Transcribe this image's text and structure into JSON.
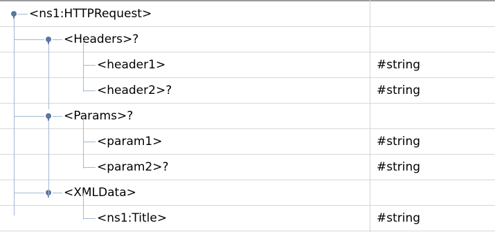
{
  "tree": {
    "rows": [
      {
        "label": "<ns1:HTTPRequest>",
        "value": "",
        "level": 0,
        "expander": "expanded"
      },
      {
        "label": "<Headers>?",
        "value": "",
        "level": 1,
        "expander": "expanded"
      },
      {
        "label": "<header1>",
        "value": "#string",
        "level": 2,
        "expander": "none"
      },
      {
        "label": "<header2>?",
        "value": "#string",
        "level": 2,
        "expander": "none"
      },
      {
        "label": "<Params>?",
        "value": "",
        "level": 1,
        "expander": "expanded"
      },
      {
        "label": "<param1>",
        "value": "#string",
        "level": 2,
        "expander": "none"
      },
      {
        "label": "<param2>?",
        "value": "#string",
        "level": 2,
        "expander": "none"
      },
      {
        "label": "<XMLData>",
        "value": "",
        "level": 1,
        "expander": "expanded"
      },
      {
        "label": "<ns1:Title>",
        "value": "#string",
        "level": 2,
        "expander": "none"
      }
    ]
  },
  "icons": {
    "expander": "tree-expanded-handle-icon"
  },
  "colors": {
    "guide_line": "#a3b8d1",
    "handle": "#5877a0",
    "row_border": "#d6d6d6",
    "top_rule": "#9a9a9a"
  }
}
